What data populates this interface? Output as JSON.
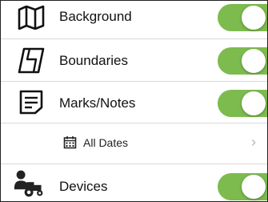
{
  "layers": [
    {
      "label": "Background",
      "icon": "map-icon",
      "enabled": true
    },
    {
      "label": "Boundaries",
      "icon": "field-boundary-icon",
      "enabled": true
    },
    {
      "label": "Marks/Notes",
      "icon": "notes-icon",
      "enabled": true
    },
    {
      "label": "Devices",
      "icon": "devices-icon",
      "enabled": true
    }
  ],
  "date_filter": {
    "label": "All Dates",
    "icon": "calendar-icon",
    "chevron": "›"
  },
  "colors": {
    "toggle_on": "#7dbb4f",
    "divider": "#d9d9d9",
    "chevron": "#b5b5b5"
  }
}
